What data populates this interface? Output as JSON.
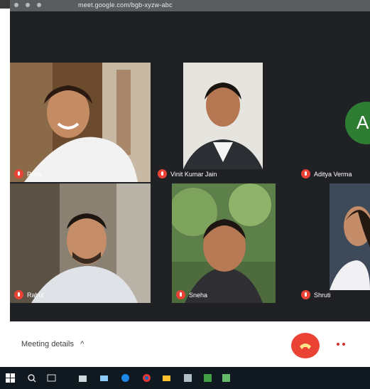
{
  "browser": {
    "url": "meet.google.com/bgb-xyzw-abc"
  },
  "participants": [
    {
      "name": "Priya"
    },
    {
      "name": "Vinit Kumar Jain"
    },
    {
      "name": "Aditya Verma"
    },
    {
      "name": "Rahul"
    },
    {
      "name": "Sneha"
    },
    {
      "name": "Shruti"
    }
  ],
  "avatar_initial": "A",
  "footer": {
    "meeting_details_label": "Meeting details",
    "chevron": "^"
  },
  "colors": {
    "meet_bg": "#202124",
    "mic_off": "#ea4335",
    "end_call": "#ea4335",
    "avatar": "#2e7d32"
  },
  "icons": [
    "windows-start-icon",
    "search-icon",
    "task-view-icon",
    "store-icon",
    "mail-icon",
    "edge-icon",
    "chrome-icon",
    "files-icon",
    "settings-icon",
    "meet-icon"
  ]
}
